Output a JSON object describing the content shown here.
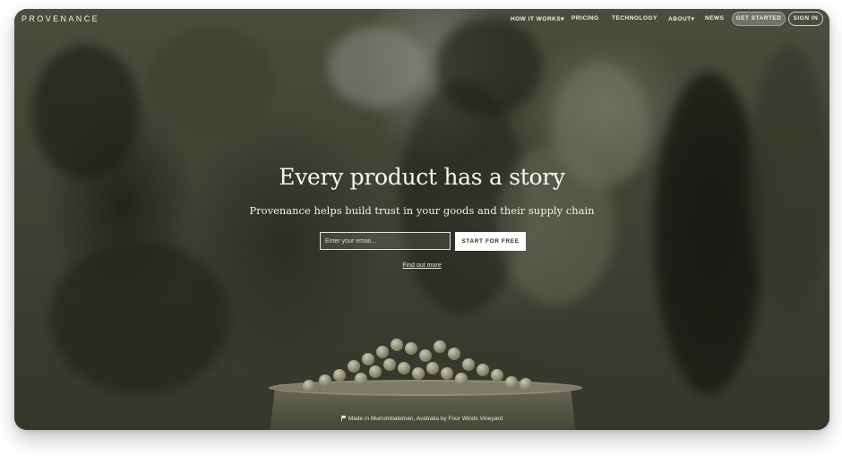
{
  "nav": {
    "logo": "PROVENANCE",
    "items": [
      {
        "label": "HOW IT WORKS",
        "has_dropdown": true
      },
      {
        "label": "PRICING",
        "has_dropdown": false
      },
      {
        "label": "TECHNOLOGY",
        "has_dropdown": false
      },
      {
        "label": "ABOUT",
        "has_dropdown": true
      },
      {
        "label": "NEWS",
        "has_dropdown": false
      }
    ],
    "get_started": "GET STARTED",
    "sign_in": "SIGN IN"
  },
  "hero": {
    "headline": "Every product has a story",
    "subline": "Provenance helps build trust in your goods and their supply chain",
    "email_placeholder": "Enter your email...",
    "cta": "START FOR FREE",
    "find_out_more": "Find out more"
  },
  "photo_caption": {
    "icon": "flag-icon",
    "text": "Made in Murrumbateman, Australia by Four Winds Vineyard"
  },
  "colors": {
    "overlay": "#4a4b3d",
    "text": "#f2f2ec",
    "button_bg": "#ffffff"
  }
}
